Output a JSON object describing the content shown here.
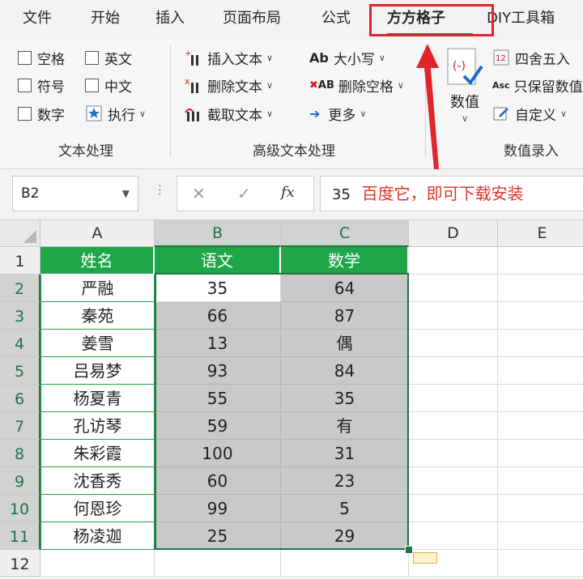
{
  "menu": {
    "tabs": [
      "文件",
      "开始",
      "插入",
      "页面布局",
      "公式",
      "方方格子",
      "DIY工具箱"
    ],
    "active_tab": "方方格子"
  },
  "ribbon": {
    "text_group": {
      "label": "文本处理",
      "checkboxes": [
        "空格",
        "英文",
        "符号",
        "中文",
        "数字"
      ],
      "execute": "执行"
    },
    "advanced_group": {
      "label": "高级文本处理",
      "insert_text": "插入文本",
      "delete_text": "删除文本",
      "extract_text": "截取文本",
      "case": "大小写",
      "remove_spaces": "删除空格",
      "more": "更多",
      "case_icon_text": "Ab",
      "spaces_icon_text": "AB"
    },
    "number_group": {
      "label": "数值录入",
      "value_button": "数值",
      "round": "四舍五入",
      "keep_value": "只保留数值",
      "custom": "自定义",
      "keep_icon_text": "Asc"
    }
  },
  "formula_bar": {
    "name_box": "B2",
    "fx_label": "fx",
    "value": "35",
    "annotation": "百度它，即可下载安装"
  },
  "sheet": {
    "columns": [
      "A",
      "B",
      "C",
      "D",
      "E"
    ],
    "rows": [
      "1",
      "2",
      "3",
      "4",
      "5",
      "6",
      "7",
      "8",
      "9",
      "10",
      "11",
      "12"
    ],
    "header": [
      "姓名",
      "语文",
      "数学"
    ],
    "data": [
      [
        "严融",
        "35",
        "64"
      ],
      [
        "秦苑",
        "66",
        "87"
      ],
      [
        "姜雪",
        "13",
        "偶"
      ],
      [
        "吕易梦",
        "93",
        "84"
      ],
      [
        "杨夏青",
        "55",
        "35"
      ],
      [
        "孔访琴",
        "59",
        "有"
      ],
      [
        "朱彩霞",
        "100",
        "31"
      ],
      [
        "沈香秀",
        "60",
        "23"
      ],
      [
        "何恩珍",
        "99",
        "5"
      ],
      [
        "杨凌迦",
        "25",
        "29"
      ]
    ]
  },
  "colors": {
    "header_green": "#1fa648",
    "excel_green": "#217346",
    "highlight_red": "#e0262a"
  }
}
